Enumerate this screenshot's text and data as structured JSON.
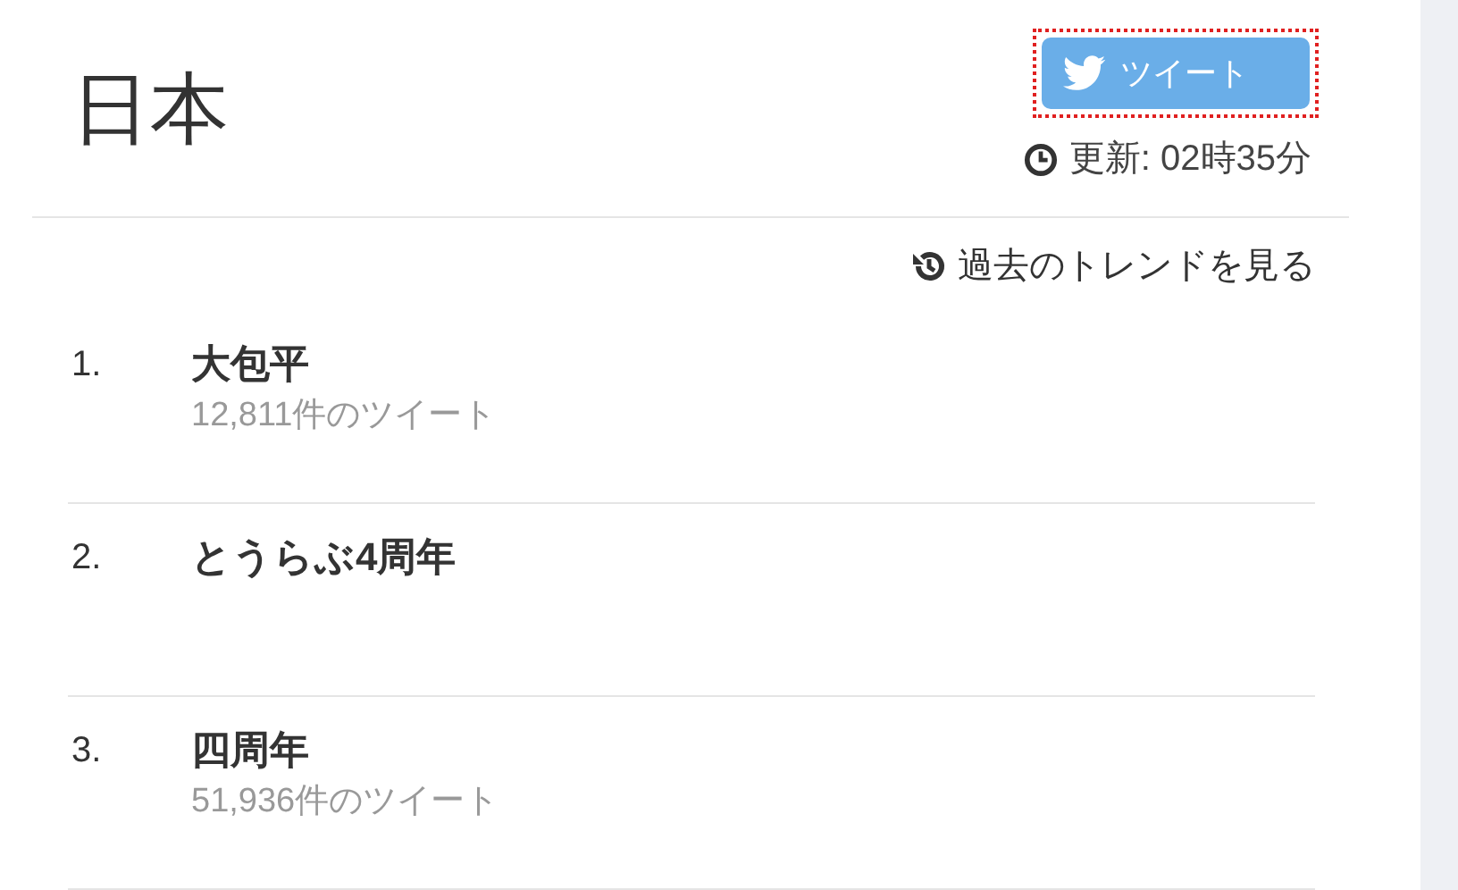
{
  "header": {
    "title": "日本",
    "tweet_button": {
      "label": "ツイート",
      "focused": true
    },
    "updated": "更新: 02時35分"
  },
  "history_link": "過去のトレンドを見る",
  "trends": [
    {
      "rank": "1.",
      "name": "大包平",
      "count": "12,811件のツイート"
    },
    {
      "rank": "2.",
      "name": "とうらぶ4周年"
    },
    {
      "rank": "3.",
      "name": "四周年",
      "count": "51,936件のツイート"
    }
  ]
}
